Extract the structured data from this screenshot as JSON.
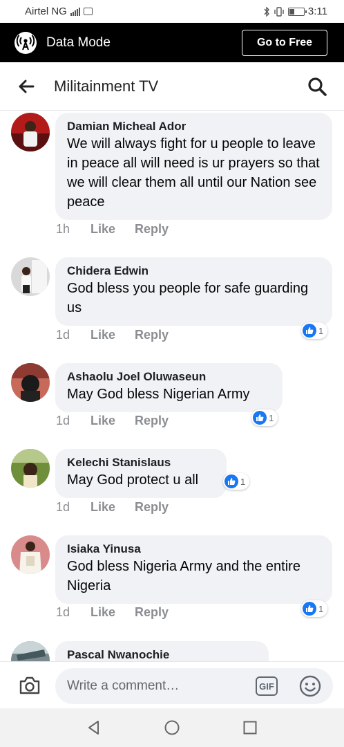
{
  "status_bar": {
    "carrier": "Airtel NG",
    "time": "3:11"
  },
  "data_bar": {
    "label": "Data Mode",
    "button": "Go to Free",
    "icon": "antenna-icon"
  },
  "header": {
    "title": "Militainment TV",
    "back_icon": "back-arrow-icon",
    "search_icon": "search-icon"
  },
  "actions": {
    "like": "Like",
    "reply": "Reply"
  },
  "comments": [
    {
      "author": "Damian Micheal Ador",
      "text": "We will always fight for u people to leave in peace all will need is ur prayers so that we will clear them all until our Nation see peace",
      "time": "1h",
      "reactions": null
    },
    {
      "author": "Chidera Edwin",
      "text": "God bless you people for safe guarding us",
      "time": "1d",
      "reactions": "1"
    },
    {
      "author": "Ashaolu Joel Oluwaseun",
      "text": "May God bless Nigerian Army",
      "time": "1d",
      "reactions": "1"
    },
    {
      "author": "Kelechi Stanislaus",
      "text": "May God protect u all",
      "time": "1d",
      "reactions": "1"
    },
    {
      "author": "Isiaka Yinusa",
      "text": "God bless Nigeria Army and the entire Nigeria",
      "time": "1d",
      "reactions": "1"
    },
    {
      "author": "Pascal Nwanochie",
      "text": "",
      "time": "",
      "reactions": null
    }
  ],
  "composer": {
    "placeholder": "Write a comment…",
    "gif_label": "GIF"
  },
  "colors": {
    "accent": "#1877f2",
    "bubble": "#f0f2f5",
    "data_bar": "#000000"
  }
}
